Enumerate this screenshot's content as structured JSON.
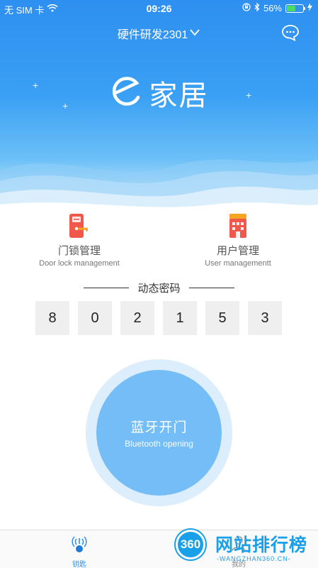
{
  "status_bar": {
    "carrier": "无 SIM 卡",
    "time": "09:26",
    "battery_percent": "56%",
    "battery_level": 0.56,
    "icons": [
      "wifi-icon",
      "orientation-lock-icon",
      "bluetooth-icon",
      "battery-icon",
      "charging-icon"
    ]
  },
  "header": {
    "title": "硬件研发2301",
    "chat_icon": "chat-bubble-icon"
  },
  "logo": {
    "mark": "e-logo-icon",
    "text": "家居"
  },
  "menu": {
    "items": [
      {
        "label": "门锁管理",
        "sublabel": "Door lock management",
        "icon": "door-lock-icon"
      },
      {
        "label": "用户管理",
        "sublabel": "User managementt",
        "icon": "user-building-icon"
      }
    ]
  },
  "dynamic_password": {
    "title": "动态密码",
    "digits": [
      "8",
      "0",
      "2",
      "1",
      "5",
      "3"
    ]
  },
  "bluetooth_button": {
    "label": "蓝牙开门",
    "sublabel": "Bluetooth opening"
  },
  "tabbar": {
    "tabs": [
      {
        "label": "钥匙",
        "icon": "signal-key-icon",
        "active": true
      },
      {
        "label": "我的",
        "icon": "person-icon",
        "active": false
      }
    ]
  },
  "watermark": {
    "badge": "360",
    "text": "网站排行榜",
    "sub": "-WANGZHAN360.CN-"
  },
  "colors": {
    "primary": "#2e8ff0",
    "button": "#74bdf6",
    "button_ring": "#dcedfb",
    "lock_icon": "#f0584c",
    "key_icon": "#f6a623"
  }
}
